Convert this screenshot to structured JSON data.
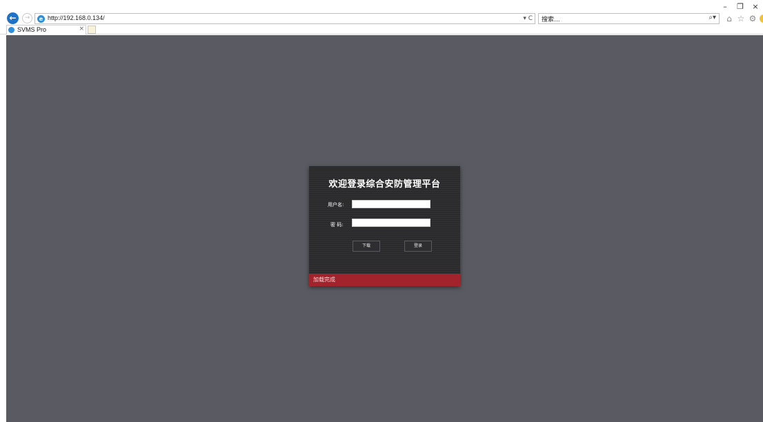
{
  "browser": {
    "window_controls": {
      "minimize": "–",
      "restore": "❐",
      "close": "×"
    },
    "back_symbol": "←",
    "forward_symbol": "→",
    "address": "http://192.168.0.134/",
    "address_tools": "▾ C",
    "search_placeholder": "搜索...",
    "search_symbol": "⌕▾",
    "tab_title": "SVMS Pro",
    "tab_close": "×",
    "toolbar_icons": [
      "home-icon",
      "favorites-icon",
      "settings-icon",
      "smiley-icon"
    ]
  },
  "login": {
    "title": "欢迎登录综合安防管理平台",
    "username_label": "用户名:",
    "username_value": "",
    "password_label": "密 码:",
    "password_value": "",
    "download_button": "下载",
    "login_button": "登录",
    "status": "加载完成"
  },
  "colors": {
    "page_background": "#5a5b62",
    "panel_background": "#2a2a2c",
    "status_background": "#a3232d"
  }
}
